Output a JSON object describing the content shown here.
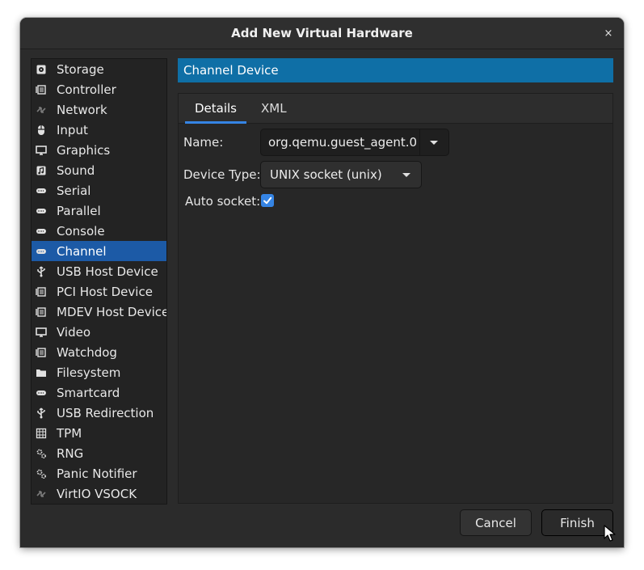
{
  "window": {
    "title": "Add New Virtual Hardware",
    "close_label": "×"
  },
  "sidebar": {
    "items": [
      {
        "label": "Storage",
        "icon": "storage-icon"
      },
      {
        "label": "Controller",
        "icon": "controller-icon"
      },
      {
        "label": "Network",
        "icon": "network-icon"
      },
      {
        "label": "Input",
        "icon": "mouse-icon"
      },
      {
        "label": "Graphics",
        "icon": "monitor-icon"
      },
      {
        "label": "Sound",
        "icon": "sound-icon"
      },
      {
        "label": "Serial",
        "icon": "serial-port-icon"
      },
      {
        "label": "Parallel",
        "icon": "parallel-port-icon"
      },
      {
        "label": "Console",
        "icon": "console-port-icon"
      },
      {
        "label": "Channel",
        "icon": "channel-port-icon",
        "selected": true
      },
      {
        "label": "USB Host Device",
        "icon": "usb-icon"
      },
      {
        "label": "PCI Host Device",
        "icon": "pci-card-icon"
      },
      {
        "label": "MDEV Host Device",
        "icon": "mdev-card-icon"
      },
      {
        "label": "Video",
        "icon": "video-monitor-icon"
      },
      {
        "label": "Watchdog",
        "icon": "watchdog-card-icon"
      },
      {
        "label": "Filesystem",
        "icon": "folder-icon"
      },
      {
        "label": "Smartcard",
        "icon": "smartcard-icon"
      },
      {
        "label": "USB Redirection",
        "icon": "usb-redirection-icon"
      },
      {
        "label": "TPM",
        "icon": "tpm-chip-icon"
      },
      {
        "label": "RNG",
        "icon": "rng-gear-icon"
      },
      {
        "label": "Panic Notifier",
        "icon": "panic-gear-icon"
      },
      {
        "label": "VirtIO VSOCK",
        "icon": "vsock-icon"
      }
    ]
  },
  "main": {
    "header": "Channel Device",
    "tabs": [
      {
        "label": "Details",
        "active": true
      },
      {
        "label": "XML",
        "active": false
      }
    ],
    "form": {
      "name_label": "Name:",
      "name_value": "org.qemu.guest_agent.0",
      "device_type_label": "Device Type:",
      "device_type_value": "UNIX socket (unix)",
      "auto_socket_label": "Auto socket:",
      "auto_socket_checked": true
    }
  },
  "buttons": {
    "cancel": "Cancel",
    "finish": "Finish"
  },
  "colors": {
    "accent": "#3584e4",
    "header_bar": "#0f6fa6",
    "selected_item": "#1c5aa6"
  }
}
